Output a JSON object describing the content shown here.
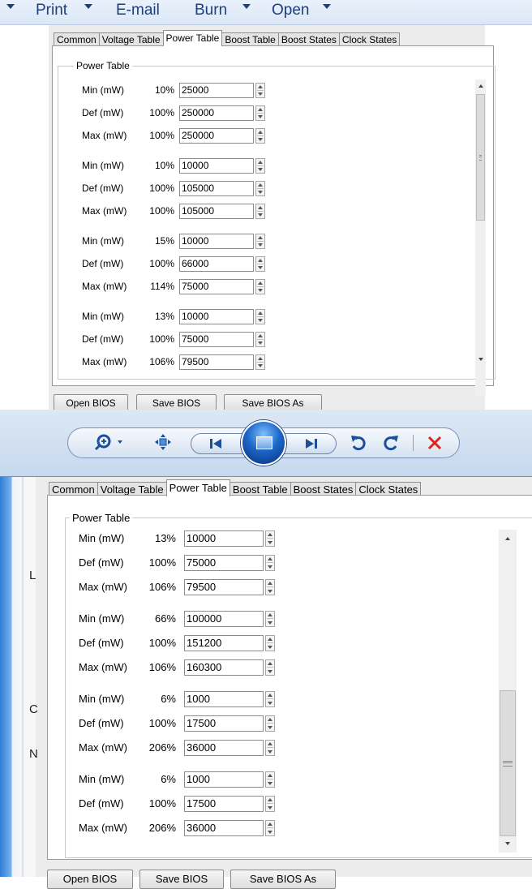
{
  "viewer_menu": {
    "items": [
      {
        "label": "Print",
        "has_arrow": true
      },
      {
        "label": "E-mail",
        "has_arrow": false
      },
      {
        "label": "Burn",
        "has_arrow": true
      },
      {
        "label": "Open",
        "has_arrow": true
      }
    ]
  },
  "app": {
    "tabs": [
      "Common",
      "Voltage Table",
      "Power Table",
      "Boost Table",
      "Boost States",
      "Clock States"
    ],
    "active_tab": "Power Table",
    "group_title": "Power Table",
    "buttons": {
      "open_bios": "Open BIOS",
      "save_bios": "Save BIOS",
      "save_bios_as": "Save BIOS As"
    }
  },
  "top_table": {
    "rows": [
      {
        "label": "Min (mW)",
        "pct": "10%",
        "value": "25000"
      },
      {
        "label": "Def (mW)",
        "pct": "100%",
        "value": "250000"
      },
      {
        "label": "Max (mW)",
        "pct": "100%",
        "value": "250000"
      },
      {
        "label": "Min (mW)",
        "pct": "10%",
        "value": "10000"
      },
      {
        "label": "Def (mW)",
        "pct": "100%",
        "value": "105000"
      },
      {
        "label": "Max (mW)",
        "pct": "100%",
        "value": "105000"
      },
      {
        "label": "Min (mW)",
        "pct": "15%",
        "value": "10000"
      },
      {
        "label": "Def (mW)",
        "pct": "100%",
        "value": "66000"
      },
      {
        "label": "Max (mW)",
        "pct": "114%",
        "value": "75000"
      },
      {
        "label": "Min (mW)",
        "pct": "13%",
        "value": "10000"
      },
      {
        "label": "Def (mW)",
        "pct": "100%",
        "value": "75000"
      },
      {
        "label": "Max (mW)",
        "pct": "106%",
        "value": "79500"
      }
    ]
  },
  "bottom_table": {
    "rows": [
      {
        "label": "Min (mW)",
        "pct": "13%",
        "value": "10000"
      },
      {
        "label": "Def (mW)",
        "pct": "100%",
        "value": "75000"
      },
      {
        "label": "Max (mW)",
        "pct": "106%",
        "value": "79500"
      },
      {
        "label": "Min (mW)",
        "pct": "66%",
        "value": "100000"
      },
      {
        "label": "Def (mW)",
        "pct": "100%",
        "value": "151200"
      },
      {
        "label": "Max (mW)",
        "pct": "106%",
        "value": "160300"
      },
      {
        "label": "Min (mW)",
        "pct": "6%",
        "value": "1000"
      },
      {
        "label": "Def (mW)",
        "pct": "100%",
        "value": "17500"
      },
      {
        "label": "Max (mW)",
        "pct": "206%",
        "value": "36000"
      },
      {
        "label": "Min (mW)",
        "pct": "6%",
        "value": "1000"
      },
      {
        "label": "Def (mW)",
        "pct": "100%",
        "value": "17500"
      },
      {
        "label": "Max (mW)",
        "pct": "206%",
        "value": "36000"
      }
    ]
  },
  "bottom_cutoff_buttons": [
    "Open BIOS",
    "Save BIOS",
    "Save BIOS As"
  ],
  "viewer_controls": {
    "icons": [
      "zoom-icon",
      "fit-window-icon",
      "previous-icon",
      "slideshow-icon",
      "next-icon",
      "rotate-left-icon",
      "rotate-right-icon",
      "delete-icon"
    ],
    "colors": {
      "accent": "#1b66c9",
      "delete": "#d9261c"
    }
  },
  "desktop_strip_letters": [
    "L",
    "C",
    "N"
  ]
}
